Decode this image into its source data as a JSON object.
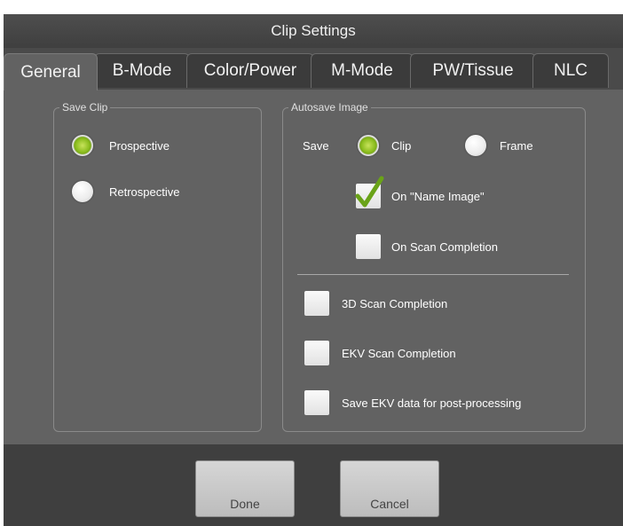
{
  "dialog": {
    "title": "Clip Settings"
  },
  "tabs": [
    {
      "label": "General",
      "active": true
    },
    {
      "label": "B-Mode",
      "active": false
    },
    {
      "label": "Color/Power",
      "active": false
    },
    {
      "label": "M-Mode",
      "active": false
    },
    {
      "label": "PW/Tissue",
      "active": false
    },
    {
      "label": "NLC",
      "active": false
    }
  ],
  "save_clip": {
    "legend": "Save Clip",
    "options": [
      {
        "label": "Prospective",
        "selected": true
      },
      {
        "label": "Retrospective",
        "selected": false
      }
    ]
  },
  "autosave": {
    "legend": "Autosave Image",
    "save_label": "Save",
    "options": [
      {
        "label": "Clip",
        "selected": true
      },
      {
        "label": "Frame",
        "selected": false
      }
    ],
    "checks": [
      {
        "label": "On \"Name Image\"",
        "checked": true
      },
      {
        "label": "On Scan Completion",
        "checked": false
      },
      {
        "label": "3D Scan Completion",
        "checked": false
      },
      {
        "label": "EKV Scan Completion",
        "checked": false
      },
      {
        "label": "Save EKV data for post-processing",
        "checked": false
      }
    ]
  },
  "footer": {
    "done_label": "Done",
    "cancel_label": "Cancel"
  },
  "colors": {
    "accent_green": "#8bbd1e",
    "check_green": "#6aa318"
  }
}
